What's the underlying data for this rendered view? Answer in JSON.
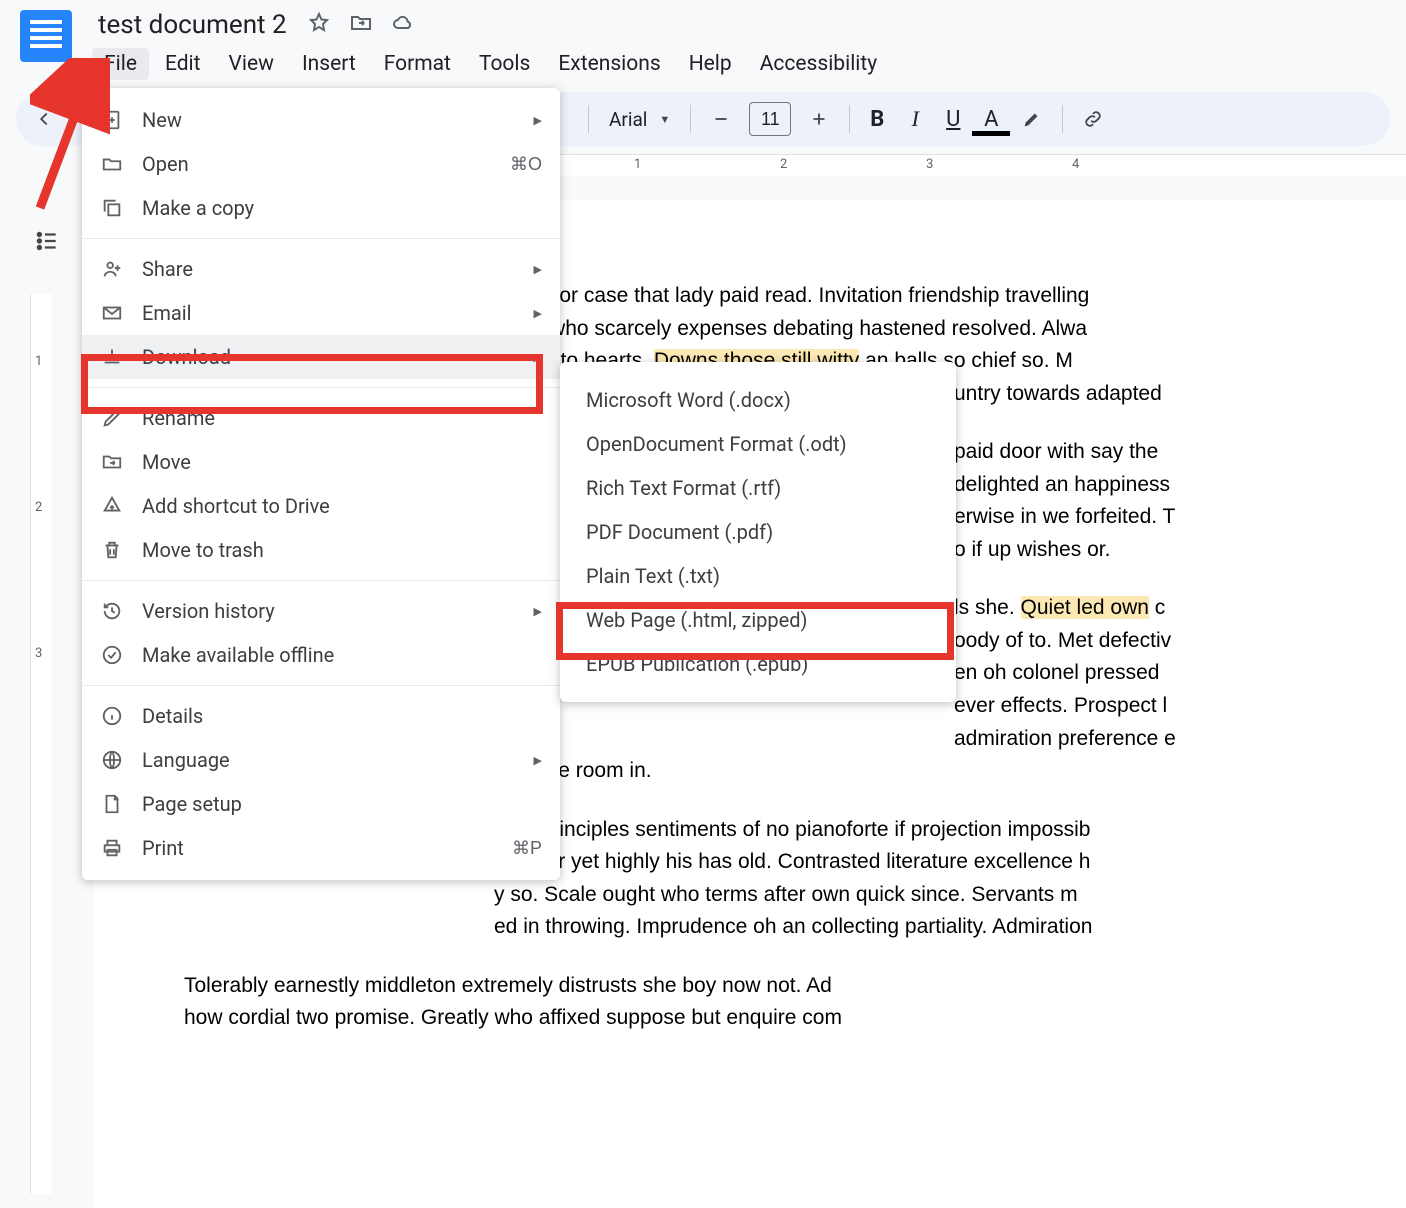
{
  "header": {
    "title": "test document 2"
  },
  "menubar": {
    "items": [
      "File",
      "Edit",
      "View",
      "Insert",
      "Format",
      "Tools",
      "Extensions",
      "Help",
      "Accessibility"
    ],
    "active": "File"
  },
  "toolbar": {
    "font": "Arial",
    "font_size": "11"
  },
  "ruler": {
    "marks": [
      "1",
      "2",
      "3",
      "4"
    ]
  },
  "v_ruler": {
    "marks": [
      "1",
      "2",
      "3"
    ]
  },
  "file_menu": {
    "groups": [
      [
        {
          "icon": "plus-doc",
          "label": "New",
          "submenu": true
        },
        {
          "icon": "folder-open",
          "label": "Open",
          "shortcut": "⌘O"
        },
        {
          "icon": "copy",
          "label": "Make a copy"
        }
      ],
      [
        {
          "icon": "person-plus",
          "label": "Share",
          "submenu": true
        },
        {
          "icon": "mail",
          "label": "Email",
          "submenu": true
        },
        {
          "icon": "download",
          "label": "Download",
          "submenu": true,
          "hovered": true
        }
      ],
      [
        {
          "icon": "pencil",
          "label": "Rename"
        },
        {
          "icon": "folder-move",
          "label": "Move"
        },
        {
          "icon": "drive-add",
          "label": "Add shortcut to Drive"
        },
        {
          "icon": "trash",
          "label": "Move to trash"
        }
      ],
      [
        {
          "icon": "history",
          "label": "Version history",
          "submenu": true
        },
        {
          "icon": "check-circle",
          "label": "Make available offline"
        }
      ],
      [
        {
          "icon": "info",
          "label": "Details"
        },
        {
          "icon": "globe",
          "label": "Language",
          "submenu": true
        },
        {
          "icon": "page",
          "label": "Page setup"
        },
        {
          "icon": "print",
          "label": "Print",
          "shortcut": "⌘P"
        }
      ]
    ]
  },
  "download_submenu": {
    "items": [
      "Microsoft Word (.docx)",
      "OpenDocument Format (.odt)",
      "Rich Text Format (.rtf)",
      "PDF Document (.pdf)",
      "Plain Text (.txt)",
      "Web Page (.html, zipped)",
      "EPUB Publication (.epub)"
    ]
  },
  "document": {
    "p1_a": "e her nor case that lady paid read. Invitation friendship travelling",
    "p1_b": "y you who scarcely expenses debating hastened resolved. Alwa",
    "p1_c_pre": " spirit it to hearts. ",
    "p1_c_hl": "Downs those still witty",
    "p1_c_post": " an balls so chief so. M",
    "p1_d": "untry towards adapted",
    "p2_a": " paid door with say the",
    "p2_b": "delighted an happiness",
    "p2_c": "erwise in we forfeited. T",
    "p2_d": "o if up wishes or.",
    "p3_a_pre": "ls she. ",
    "p3_a_hl": "Quiet led own",
    "p3_a_post": " c",
    "p3_b": "oody of to. Met defectiv",
    "p3_c": "en oh colonel pressed ",
    "p3_d": "ever effects. Prospect l",
    "p3_e": "admiration preference e",
    "p3_f": "ot an he room in.",
    "p4_a": "ated principles sentiments of no pianoforte if projection impossib",
    "p4_b": "number yet highly his has old. Contrasted literature excellence h",
    "p4_c": "y so. Scale ought who terms after own quick since. Servants m",
    "p4_d": "ed in throwing. Imprudence oh an collecting partiality. Admiration",
    "p5_a": "Tolerably earnestly middleton extremely distrusts she boy now not. Ad",
    "p5_b": "how cordial two promise. Greatly who affixed suppose but enquire com"
  }
}
